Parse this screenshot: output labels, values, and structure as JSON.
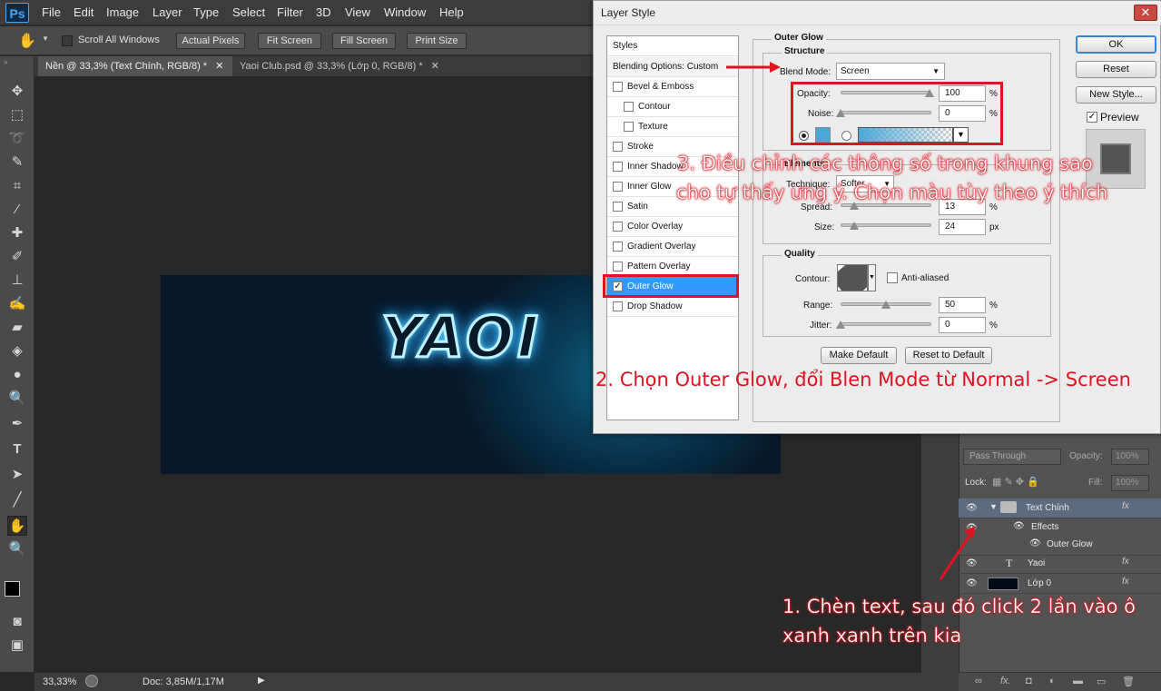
{
  "menubar": {
    "logo": "Ps",
    "items": [
      "File",
      "Edit",
      "Image",
      "Layer",
      "Type",
      "Select",
      "Filter",
      "3D",
      "View",
      "Window",
      "Help"
    ]
  },
  "options": {
    "scroll_all": "Scroll All Windows",
    "buttons": [
      "Actual Pixels",
      "Fit Screen",
      "Fill Screen",
      "Print Size"
    ]
  },
  "tabs": [
    {
      "label": "Nền @ 33,3% (Text Chính, RGB/8) *",
      "active": true
    },
    {
      "label": "Yaoi Club.psd @ 33,3% (Lớp 0, RGB/8) *",
      "active": false
    }
  ],
  "canvas": {
    "text": "YAOI",
    "glow_color": "#3bb7ff"
  },
  "status": {
    "zoom": "33,33%",
    "doc": "Doc: 3,85M/1,17M"
  },
  "layers": {
    "blend": "Pass Through",
    "opacity_label": "Opacity:",
    "opacity": "100%",
    "lock_label": "Lock:",
    "fill_label": "Fill:",
    "fill": "100%",
    "rows": [
      {
        "name": "Text Chính",
        "fx": "fx"
      },
      {
        "name": "Effects"
      },
      {
        "name": "Outer Glow"
      },
      {
        "name": "Yaoi",
        "fx": "fx"
      },
      {
        "name": "Lớp 0",
        "fx": "fx"
      }
    ]
  },
  "dialog": {
    "title": "Layer Style",
    "close": "✕",
    "styles_header": "Styles",
    "blending": "Blending Options: Custom",
    "styles": [
      {
        "label": "Bevel & Emboss",
        "checked": false,
        "indent": false
      },
      {
        "label": "Contour",
        "checked": false,
        "indent": true
      },
      {
        "label": "Texture",
        "checked": false,
        "indent": true
      },
      {
        "label": "Stroke",
        "checked": false,
        "indent": false
      },
      {
        "label": "Inner Shadow",
        "checked": false,
        "indent": false
      },
      {
        "label": "Inner Glow",
        "checked": false,
        "indent": false
      },
      {
        "label": "Satin",
        "checked": false,
        "indent": false
      },
      {
        "label": "Color Overlay",
        "checked": false,
        "indent": false
      },
      {
        "label": "Gradient Overlay",
        "checked": false,
        "indent": false
      },
      {
        "label": "Pattern Overlay",
        "checked": false,
        "indent": false
      },
      {
        "label": "Outer Glow",
        "checked": true,
        "indent": false
      },
      {
        "label": "Drop Shadow",
        "checked": false,
        "indent": false
      }
    ],
    "section_title": "Outer Glow",
    "structure_title": "Structure",
    "blend_mode_label": "Blend Mode:",
    "blend_mode": "Screen",
    "opacity_label": "Opacity:",
    "opacity_value": "100",
    "noise_label": "Noise:",
    "noise_value": "0",
    "percent": "%",
    "px": "px",
    "glow_color": "#4aa8d8",
    "elements_title": "Elements",
    "technique_label": "Technique:",
    "technique_value": "Softer",
    "spread_label": "Spread:",
    "spread_value": "13",
    "size_label": "Size:",
    "size_value": "24",
    "quality_title": "Quality",
    "contour_label": "Contour:",
    "antialiased": "Anti-aliased",
    "range_label": "Range:",
    "range_value": "50",
    "jitter_label": "Jitter:",
    "jitter_value": "0",
    "make_default": "Make Default",
    "reset_default": "Reset to Default",
    "ok": "OK",
    "reset": "Reset",
    "new_style": "New Style...",
    "preview": "Preview"
  },
  "annotations": {
    "step3_line1": "3. Điều chỉnh các thông số trong khung sao",
    "step3_line2": "cho tự thấy ưng ý. Chọn màu tùy theo ý thích",
    "step2": "2. Chọn Outer Glow, đổi Blen Mode từ Normal -> Screen",
    "step1_line1": "1. Chèn text, sau đó click 2 lần vào ô",
    "step1_line2": "xanh xanh trên kia"
  }
}
